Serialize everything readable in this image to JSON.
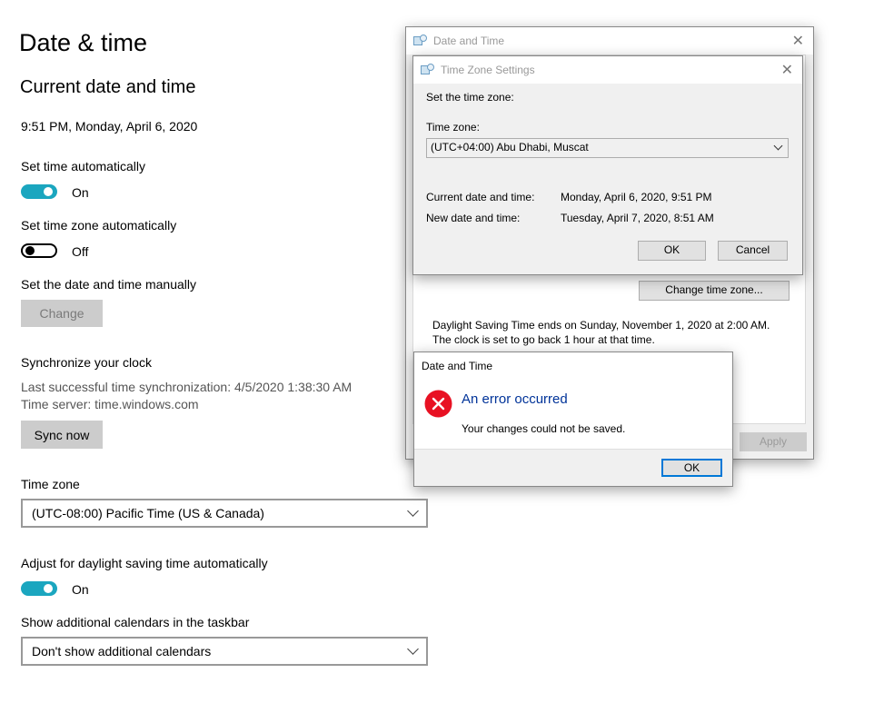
{
  "settings": {
    "page_title": "Date & time",
    "section_title": "Current date and time",
    "current_datetime": "9:51 PM, Monday, April 6, 2020",
    "set_time_auto": {
      "label": "Set time automatically",
      "state": "On"
    },
    "set_tz_auto": {
      "label": "Set time zone automatically",
      "state": "Off"
    },
    "manual": {
      "label": "Set the date and time manually",
      "button": "Change"
    },
    "sync": {
      "title": "Synchronize your clock",
      "last_sync": "Last successful time synchronization: 4/5/2020 1:38:30 AM",
      "server": "Time server: time.windows.com",
      "button": "Sync now"
    },
    "timezone": {
      "label": "Time zone",
      "value": "(UTC-08:00) Pacific Time (US & Canada)"
    },
    "dst": {
      "label": "Adjust for daylight saving time automatically",
      "state": "On"
    },
    "calendars": {
      "label": "Show additional calendars in the taskbar",
      "value": "Don't show additional calendars"
    }
  },
  "date_time_dialog": {
    "title": "Date and Time",
    "change_tz_button": "Change time zone...",
    "dst_note": "Daylight Saving Time ends on Sunday, November 1, 2020 at 2:00 AM. The clock is set to go back 1 hour at that time.",
    "apply_button": "Apply"
  },
  "tz_dialog": {
    "title": "Time Zone Settings",
    "prompt": "Set the time zone:",
    "tz_label": "Time zone:",
    "tz_value": "(UTC+04:00) Abu Dhabi, Muscat",
    "current_label": "Current date and time:",
    "current_value": "Monday, April 6, 2020, 9:51 PM",
    "new_label": "New date and time:",
    "new_value": "Tuesday, April 7, 2020, 8:51 AM",
    "ok_button": "OK",
    "cancel_button": "Cancel"
  },
  "error_dialog": {
    "title": "Date and Time",
    "heading": "An error occurred",
    "message": "Your changes could not be saved.",
    "ok_button": "OK"
  },
  "colors": {
    "accent": "#1ba6bf",
    "error": "#e81123",
    "link_blue": "#003399"
  }
}
